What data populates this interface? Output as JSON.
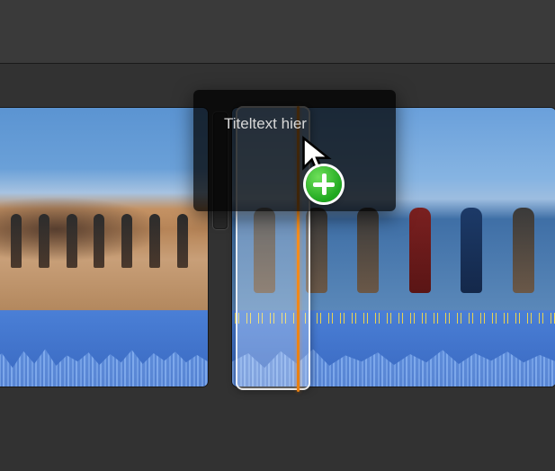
{
  "title_overlay": {
    "placeholder_text": "Titeltext hier"
  },
  "drag_cursor": {
    "badge": "plus"
  },
  "timeline": {
    "clips": [
      {
        "kind": "video",
        "scene": "desert-group",
        "has_audio": true
      },
      {
        "kind": "video",
        "scene": "beach-group",
        "has_audio": true
      }
    ],
    "drop_target_clip_index": 1
  }
}
